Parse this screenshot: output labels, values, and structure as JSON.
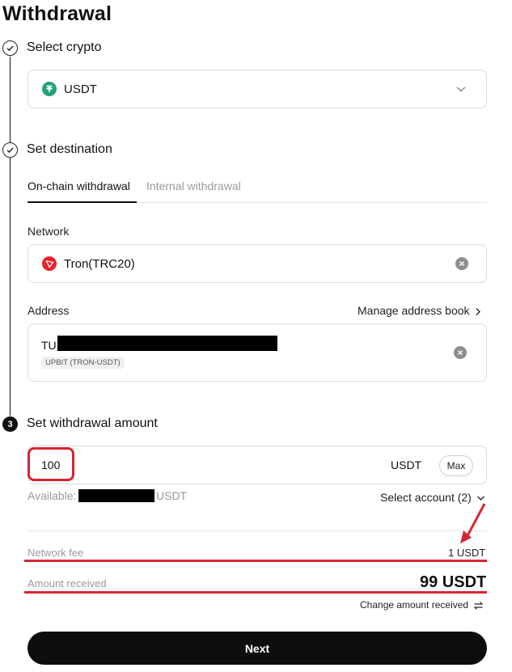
{
  "header": {
    "title": "Withdrawal"
  },
  "steps": {
    "select_crypto": {
      "title": "Select crypto",
      "coin": {
        "symbol": "USDT",
        "icon": "tether-icon",
        "color": "#26a17b"
      }
    },
    "set_destination": {
      "title": "Set destination",
      "tabs": [
        {
          "label": "On-chain withdrawal",
          "active": true
        },
        {
          "label": "Internal withdrawal",
          "active": false
        }
      ],
      "network": {
        "label": "Network",
        "value": "Tron(TRC20)",
        "icon": "tron-icon",
        "color": "#e5252a"
      },
      "address": {
        "label": "Address",
        "manage_link": "Manage address book",
        "value_prefix": "TU",
        "tag": "UPBIT (TRON-USDT)"
      }
    },
    "set_amount": {
      "step_number": "3",
      "title": "Set withdrawal amount",
      "amount_value": "100",
      "unit": "USDT",
      "max_label": "Max",
      "available_label": "Available:",
      "available_unit": "USDT",
      "select_account": "Select account (2)"
    }
  },
  "summary": {
    "fee_label": "Network fee",
    "fee_value": "1 USDT",
    "received_label": "Amount received",
    "received_value": "99 USDT",
    "change_link": "Change amount received"
  },
  "footer": {
    "next_label": "Next"
  },
  "annotation_color": "#d62633"
}
